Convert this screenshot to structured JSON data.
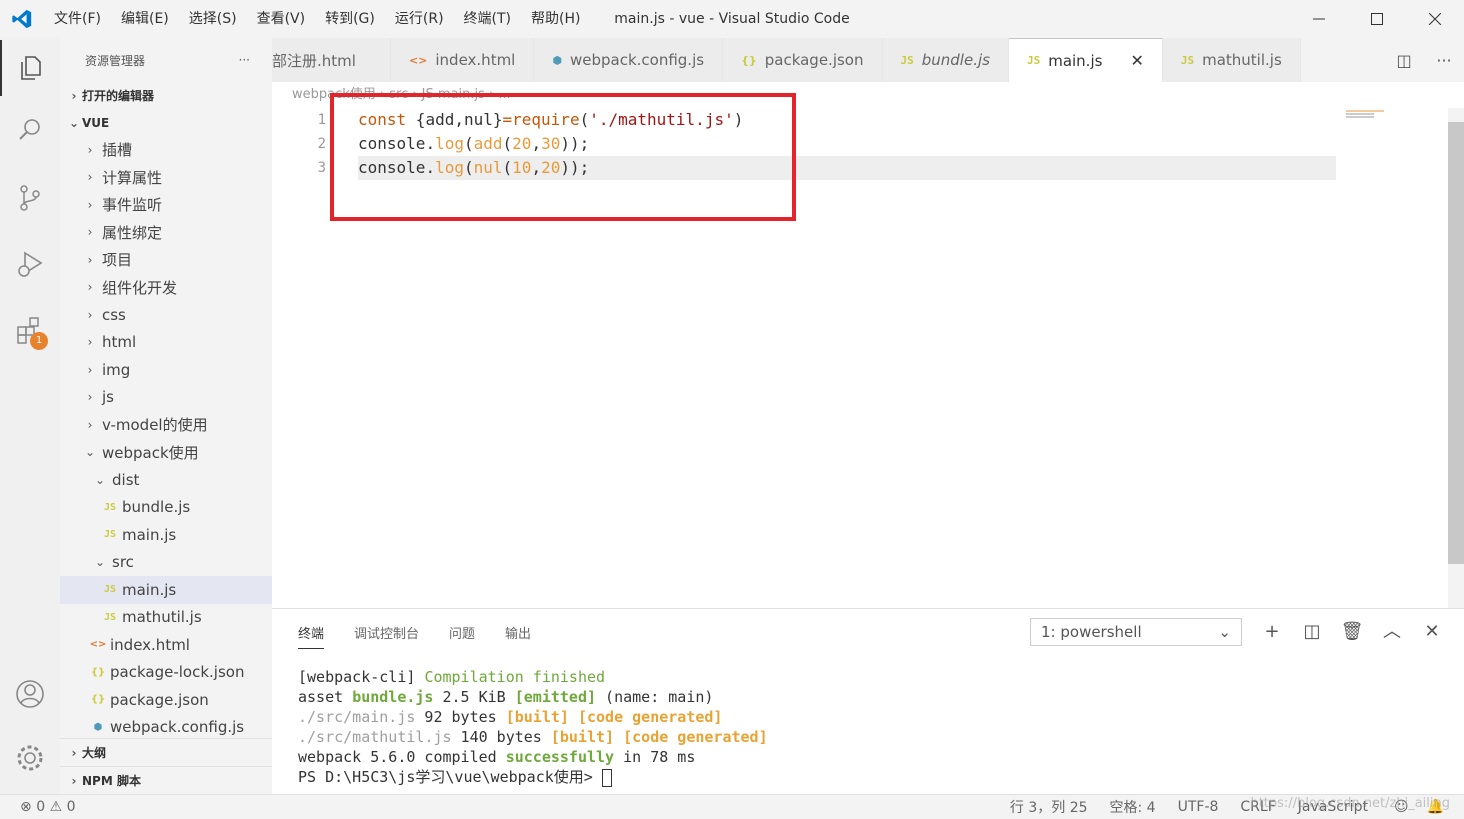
{
  "titlebar": {
    "menu": [
      "文件(F)",
      "编辑(E)",
      "选择(S)",
      "查看(V)",
      "转到(G)",
      "运行(R)",
      "终端(T)",
      "帮助(H)"
    ],
    "title": "main.js - vue - Visual Studio Code"
  },
  "activitybar": {
    "icons": [
      "explorer-icon",
      "search-icon",
      "source-control-icon",
      "run-debug-icon",
      "extensions-icon",
      "account-icon",
      "settings-gear-icon"
    ],
    "extensions_badge": "1"
  },
  "sidebar": {
    "title": "资源管理器",
    "more": "···",
    "open_editors": "打开的编辑器",
    "root": "VUE",
    "folders": [
      "插槽",
      "计算属性",
      "事件监听",
      "属性绑定",
      "项目",
      "组件化开发",
      "css",
      "html",
      "img",
      "js",
      "v-model的使用"
    ],
    "webpack_folder": "webpack使用",
    "dist_folder": "dist",
    "dist_files": [
      {
        "icon": "JS",
        "name": "bundle.js"
      },
      {
        "icon": "JS",
        "name": "main.js"
      }
    ],
    "src_folder": "src",
    "src_files": [
      {
        "icon": "JS",
        "name": "main.js"
      },
      {
        "icon": "JS",
        "name": "mathutil.js"
      }
    ],
    "root_files": [
      {
        "icon": "<>",
        "name": "index.html"
      },
      {
        "icon": "{}",
        "name": "package-lock.json"
      },
      {
        "icon": "{}",
        "name": "package.json"
      },
      {
        "icon": "⬢",
        "name": "webpack.config.js"
      }
    ],
    "outline": "大纲",
    "npm_scripts": "NPM 脚本"
  },
  "tabs": [
    {
      "icon": "",
      "label": "部注册.html"
    },
    {
      "icon": "<>",
      "label": "index.html"
    },
    {
      "icon": "⬢",
      "label": "webpack.config.js"
    },
    {
      "icon": "{}",
      "label": "package.json"
    },
    {
      "icon": "JS",
      "label": "bundle.js"
    },
    {
      "icon": "JS",
      "label": "main.js",
      "close": "✕"
    },
    {
      "icon": "JS",
      "label": "mathutil.js"
    }
  ],
  "breadcrumb": "webpack使用 › src › JS main.js › ...",
  "editor": {
    "line_numbers": [
      "1",
      "2",
      "3"
    ],
    "lines": [
      [
        {
          "t": "const",
          "c": "kw"
        },
        {
          "t": " {add,nul}",
          "c": "plain"
        },
        {
          "t": "=",
          "c": "kw"
        },
        {
          "t": "require",
          "c": "kw"
        },
        {
          "t": "(",
          "c": "plain"
        },
        {
          "t": "'./mathutil.js'",
          "c": "str"
        },
        {
          "t": ")",
          "c": "plain"
        }
      ],
      [
        {
          "t": "console",
          "c": "plain"
        },
        {
          "t": ".",
          "c": "plain"
        },
        {
          "t": "log",
          "c": "fn"
        },
        {
          "t": "(",
          "c": "plain"
        },
        {
          "t": "add",
          "c": "fn"
        },
        {
          "t": "(",
          "c": "plain"
        },
        {
          "t": "20",
          "c": "num"
        },
        {
          "t": ",",
          "c": "plain"
        },
        {
          "t": "30",
          "c": "num"
        },
        {
          "t": "));",
          "c": "plain"
        }
      ],
      [
        {
          "t": "console",
          "c": "plain"
        },
        {
          "t": ".",
          "c": "plain"
        },
        {
          "t": "log",
          "c": "fn"
        },
        {
          "t": "(",
          "c": "plain"
        },
        {
          "t": "nul",
          "c": "fn"
        },
        {
          "t": "(",
          "c": "plain"
        },
        {
          "t": "10",
          "c": "num"
        },
        {
          "t": ",",
          "c": "plain"
        },
        {
          "t": "20",
          "c": "num"
        },
        {
          "t": "));",
          "c": "plain"
        }
      ]
    ]
  },
  "panel": {
    "tabs": [
      "终端",
      "调试控制台",
      "问题",
      "输出"
    ],
    "terminal_select": "1: powershell",
    "actions": [
      "+",
      "⊟",
      "🗑",
      "︿",
      "✕"
    ],
    "terminal_lines": [
      [
        {
          "t": "[webpack-cli] ",
          "c": ""
        },
        {
          "t": "Compilation finished",
          "c": "t-green"
        }
      ],
      [
        {
          "t": "asset ",
          "c": ""
        },
        {
          "t": "bundle.js",
          "c": "t-green-b"
        },
        {
          "t": " 2.5 KiB ",
          "c": ""
        },
        {
          "t": "[emitted]",
          "c": "t-green-b"
        },
        {
          "t": " (name: main)",
          "c": ""
        }
      ],
      [
        {
          "t": "./src/main.js",
          "c": "t-dim"
        },
        {
          "t": " 92 bytes ",
          "c": ""
        },
        {
          "t": "[built]",
          "c": "t-yellow-b"
        },
        {
          "t": " ",
          "c": ""
        },
        {
          "t": "[code generated]",
          "c": "t-yellow-b"
        }
      ],
      [
        {
          "t": "./src/mathutil.js",
          "c": "t-dim"
        },
        {
          "t": " 140 bytes ",
          "c": ""
        },
        {
          "t": "[built]",
          "c": "t-yellow-b"
        },
        {
          "t": " ",
          "c": ""
        },
        {
          "t": "[code generated]",
          "c": "t-yellow-b"
        }
      ],
      [
        {
          "t": "webpack 5.6.0 compiled ",
          "c": ""
        },
        {
          "t": "successfully",
          "c": "t-green-b"
        },
        {
          "t": " in 78 ms",
          "c": ""
        }
      ],
      [
        {
          "t": "PS D:\\H5C3\\js学习\\vue\\webpack使用> ",
          "c": ""
        }
      ]
    ]
  },
  "statusbar": {
    "errors": "0",
    "warnings": "0",
    "position": "行 3，列 25",
    "spaces": "空格: 4",
    "encoding": "UTF-8",
    "eol": "CRLF",
    "language": "JavaScript"
  },
  "watermark": "https://blog.csdn.net/zhi_ailing",
  "colors": {
    "accent": "#007acc",
    "highlight_box": "#e3242b",
    "badge": "#e8822c"
  }
}
